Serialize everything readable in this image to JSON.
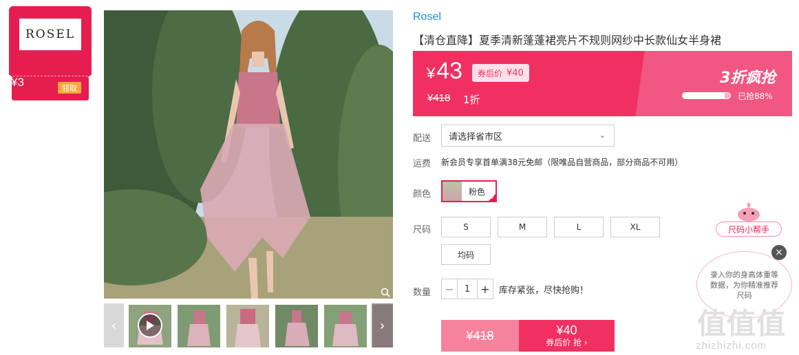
{
  "store": {
    "logo_text": "ROSEL",
    "coupon_value": "¥3",
    "coupon_action": "领取"
  },
  "gallery": {
    "thumb_count": 6,
    "prev_arrow": "‹",
    "next_arrow": "›"
  },
  "product": {
    "brand": "Rosel",
    "title": "【清仓直降】夏季清新蓬蓬裙亮片不规则网纱中长款仙女半身裙"
  },
  "price": {
    "currency": "¥",
    "current": "43",
    "after_coupon_label": "券后价",
    "after_coupon_value": "¥40",
    "original": "¥418",
    "discount": "1折",
    "sale_tag": "3折疯抢",
    "sold_percent": 88,
    "sold_text": "已抢88%",
    "colors": {
      "banner": "#f03060",
      "accent": "#e61e4f"
    }
  },
  "delivery": {
    "label": "配送",
    "placeholder": "请选择省市区"
  },
  "shipping": {
    "label": "运费",
    "text": "新会员专享首单满38元免邮（限唯品自营商品，部分商品不可用）"
  },
  "color": {
    "label": "颜色",
    "options": [
      {
        "label": "粉色",
        "selected": true
      }
    ]
  },
  "size": {
    "label": "尺码",
    "options": [
      "S",
      "M",
      "L",
      "XL",
      "均码"
    ]
  },
  "quantity": {
    "label": "数量",
    "value": "1",
    "minus": "−",
    "plus": "+",
    "stock_note": "库存紧张，尽快抢购！"
  },
  "buy": {
    "original": "¥418",
    "price": "¥40",
    "action": "券后价 抢 ›"
  },
  "size_helper": {
    "button": "尺码小帮手",
    "bubble": "录入你的身高体重等数据，为你精准推荐尺码",
    "close": "×"
  },
  "watermark": {
    "big": "值值值",
    "small": "zhizhizhi.com"
  }
}
